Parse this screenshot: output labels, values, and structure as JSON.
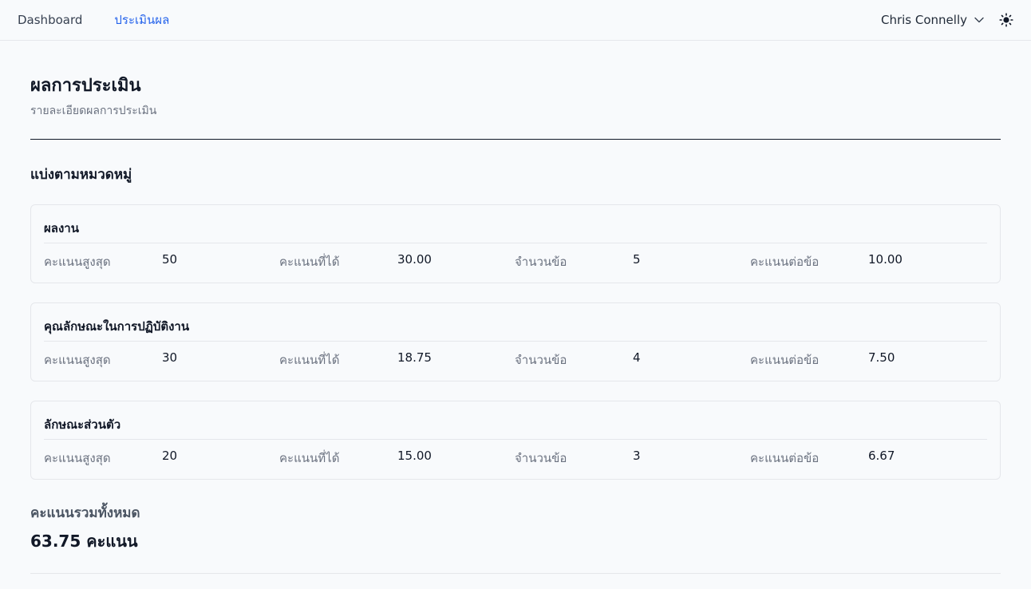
{
  "nav": {
    "dashboard": "Dashboard",
    "evaluation": "ประเมินผล",
    "user_name": "Chris Connelly",
    "icons": {
      "dropdown": "chevron-down-icon",
      "theme": "sun-icon"
    },
    "accent": "#2563eb"
  },
  "header": {
    "title": "ผลการประเมิน",
    "subtitle": "รายละเอียดผลการประเมิน"
  },
  "section_title": "แบ่งตามหมวดหมู่",
  "labels": {
    "max_score": "คะแนนสูงสุด",
    "score": "คะแนนที่ได้",
    "items": "จำนวนข้อ",
    "per_item": "คะแนนต่อข้อ"
  },
  "categories": [
    {
      "name": "ผลงาน",
      "max_score": "50",
      "score": "30.00",
      "items": "5",
      "per_item": "10.00"
    },
    {
      "name": "คุณลักษณะในการปฏิบัติงาน",
      "max_score": "30",
      "score": "18.75",
      "items": "4",
      "per_item": "7.50"
    },
    {
      "name": "ลักษณะส่วนตัว",
      "max_score": "20",
      "score": "15.00",
      "items": "3",
      "per_item": "6.67"
    }
  ],
  "total": {
    "label": "คะแนนรวมทั้งหมด",
    "value": "63.75 คะแนน"
  }
}
